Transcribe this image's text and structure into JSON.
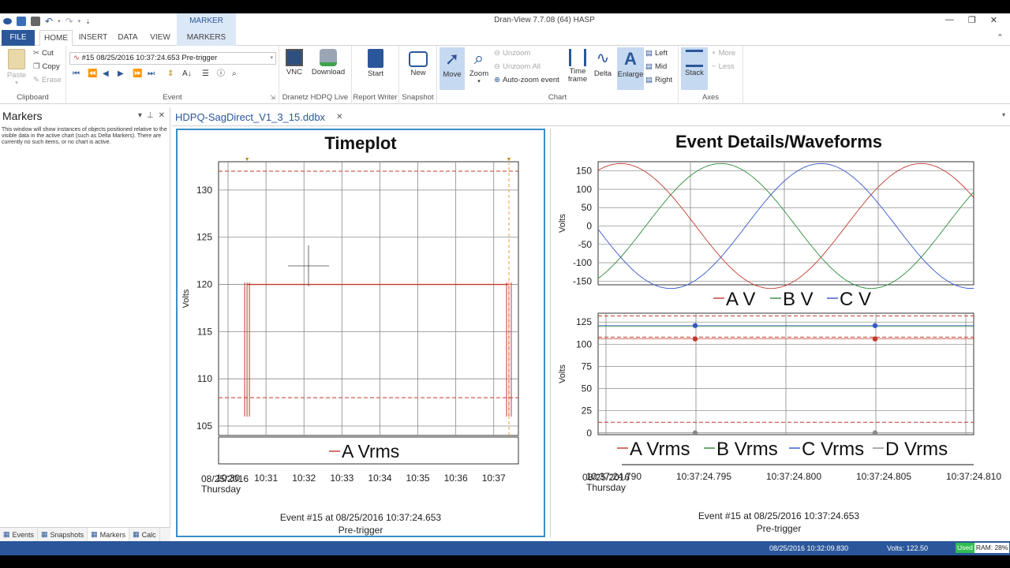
{
  "app": {
    "window_title": "Dran-View 7.7.08 (64) HASP",
    "context_tab": "MARKER TOOLS"
  },
  "ribbon_tabs": [
    "FILE",
    "HOME",
    "INSERT",
    "DATA",
    "VIEW",
    "MARKERS"
  ],
  "clipboard": {
    "paste": "Paste",
    "cut": "Cut",
    "copy": "Copy",
    "erase": "Erase",
    "label": "Clipboard"
  },
  "event_group": {
    "combo_value": "#15 08/25/2016 10:37:24.653  Pre-trigger",
    "label": "Event"
  },
  "dranetz_group": {
    "vnc": "VNC",
    "download": "Download",
    "label": "Dranetz HDPQ Live"
  },
  "report_group": {
    "start": "Start",
    "label": "Report Writer"
  },
  "snapshot_group": {
    "new": "New",
    "label": "Snapshot"
  },
  "chart_group": {
    "move": "Move",
    "zoom": "Zoom",
    "unzoom": "Unzoom",
    "unzoom_all": "Unzoom All",
    "autozoom": "Auto-zoom event",
    "timeframe": "Time frame",
    "delta": "Delta",
    "enlarge": "Enlarge",
    "left": "Left",
    "mid": "Mid",
    "right": "Right",
    "label": "Chart"
  },
  "axes_group": {
    "stack": "Stack",
    "more": "More",
    "less": "Less",
    "label": "Axes"
  },
  "markers_panel": {
    "title": "Markers",
    "body": "This window will show instances of objects positioned relative to the visible data in the active chart (such as Delta Markers). There are currently no such items, or no chart is active.",
    "tabs": [
      "Events",
      "Snapshots",
      "Markers",
      "Calc"
    ]
  },
  "document_tab": "HDPQ-SagDirect_V1_3_15.ddbx",
  "timeplot": {
    "title": "Timeplot",
    "footer_line1": "Event #15 at 08/25/2016 10:37:24.653",
    "footer_line2": "Pre-trigger",
    "x_date": "08/25/2016",
    "x_day": "Thursday"
  },
  "event_details": {
    "title": "Event Details/Waveforms",
    "footer_line1": "Event #15 at 08/25/2016 10:37:24.653",
    "footer_line2": "Pre-trigger",
    "x_date": "08/25/2016",
    "x_day": "Thursday"
  },
  "status": {
    "timestamp": "08/25/2016 10:32:09.830",
    "volts": "Volts: 122.50",
    "used": "Used",
    "ram": "RAM: 28%"
  },
  "colors": {
    "accent": "#2b579a",
    "phase_a": "#c0392b",
    "phase_b": "#2e8b3a",
    "phase_c": "#3556c9",
    "limit": "#c0392b"
  },
  "chart_data": [
    {
      "type": "line",
      "title": "Timeplot",
      "ylabel": "Volts",
      "ylim": [
        104,
        133
      ],
      "yticks": [
        105,
        110,
        115,
        120,
        125,
        130
      ],
      "x_ticks": [
        "10:30",
        "10:31",
        "10:32",
        "10:33",
        "10:34",
        "10:35",
        "10:36",
        "10:37"
      ],
      "limits": [
        132,
        108
      ],
      "series": [
        {
          "name": "A Vrms",
          "color": "#c0392b",
          "nominal": 120
        }
      ],
      "events": [
        {
          "x": "10:30:30",
          "min": 106,
          "max": 120.2
        },
        {
          "x": "10:37:24",
          "min": 106,
          "max": 120.2
        }
      ]
    },
    {
      "type": "line",
      "ylabel": "Volts",
      "ylim": [
        -160,
        175
      ],
      "yticks": [
        150,
        100,
        50,
        0,
        -50,
        -100,
        -150
      ],
      "amplitude": 170,
      "series": [
        {
          "name": "A V",
          "color": "#c0392b"
        },
        {
          "name": "B V",
          "color": "#2e8b3a"
        },
        {
          "name": "C V",
          "color": "#3556c9"
        }
      ]
    },
    {
      "type": "line",
      "ylabel": "Volts",
      "ylim": [
        -2,
        135
      ],
      "yticks": [
        125,
        100,
        75,
        50,
        25,
        0
      ],
      "x_ticks": [
        "10:37:24.790",
        "10:37:24.795",
        "10:37:24.800",
        "10:37:24.805",
        "10:37:24.810"
      ],
      "limits": [
        132,
        108,
        12
      ],
      "series": [
        {
          "name": "A Vrms",
          "color": "#c0392b",
          "value": 106
        },
        {
          "name": "B Vrms",
          "color": "#2e8b3a",
          "value": 120
        },
        {
          "name": "C Vrms",
          "color": "#3556c9",
          "value": 121
        },
        {
          "name": "D Vrms",
          "color": "#888888",
          "value": 0
        }
      ]
    }
  ]
}
